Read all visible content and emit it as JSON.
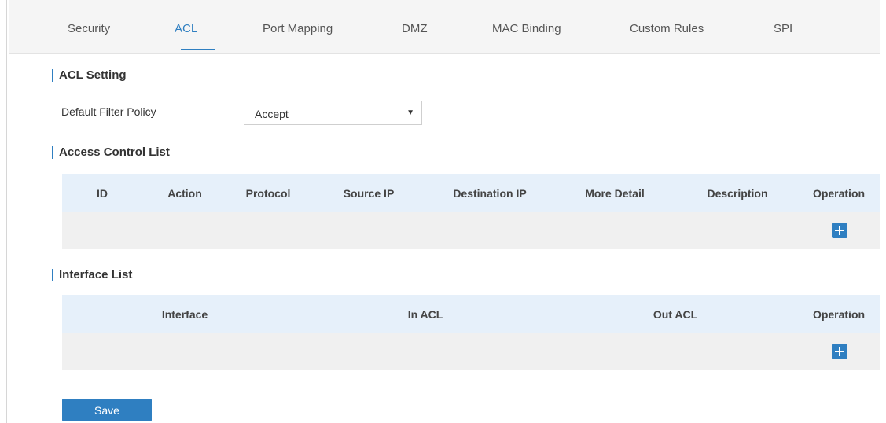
{
  "tabs": [
    {
      "label": "Security"
    },
    {
      "label": "ACL"
    },
    {
      "label": "Port Mapping"
    },
    {
      "label": "DMZ"
    },
    {
      "label": "MAC Binding"
    },
    {
      "label": "Custom Rules"
    },
    {
      "label": "SPI"
    }
  ],
  "active_tab": "ACL",
  "accent_color": "#2f7fc1",
  "acl_setting": {
    "title": "ACL Setting",
    "default_filter_policy_label": "Default Filter Policy",
    "default_filter_policy_value": "Accept"
  },
  "access_control_list": {
    "title": "Access Control List",
    "columns": [
      "ID",
      "Action",
      "Protocol",
      "Source IP",
      "Destination IP",
      "More Detail",
      "Description",
      "Operation"
    ],
    "add_icon": "plus-icon"
  },
  "interface_list": {
    "title": "Interface List",
    "columns": [
      "Interface",
      "In ACL",
      "Out ACL",
      "Operation"
    ],
    "add_icon": "plus-icon"
  },
  "save_label": "Save"
}
